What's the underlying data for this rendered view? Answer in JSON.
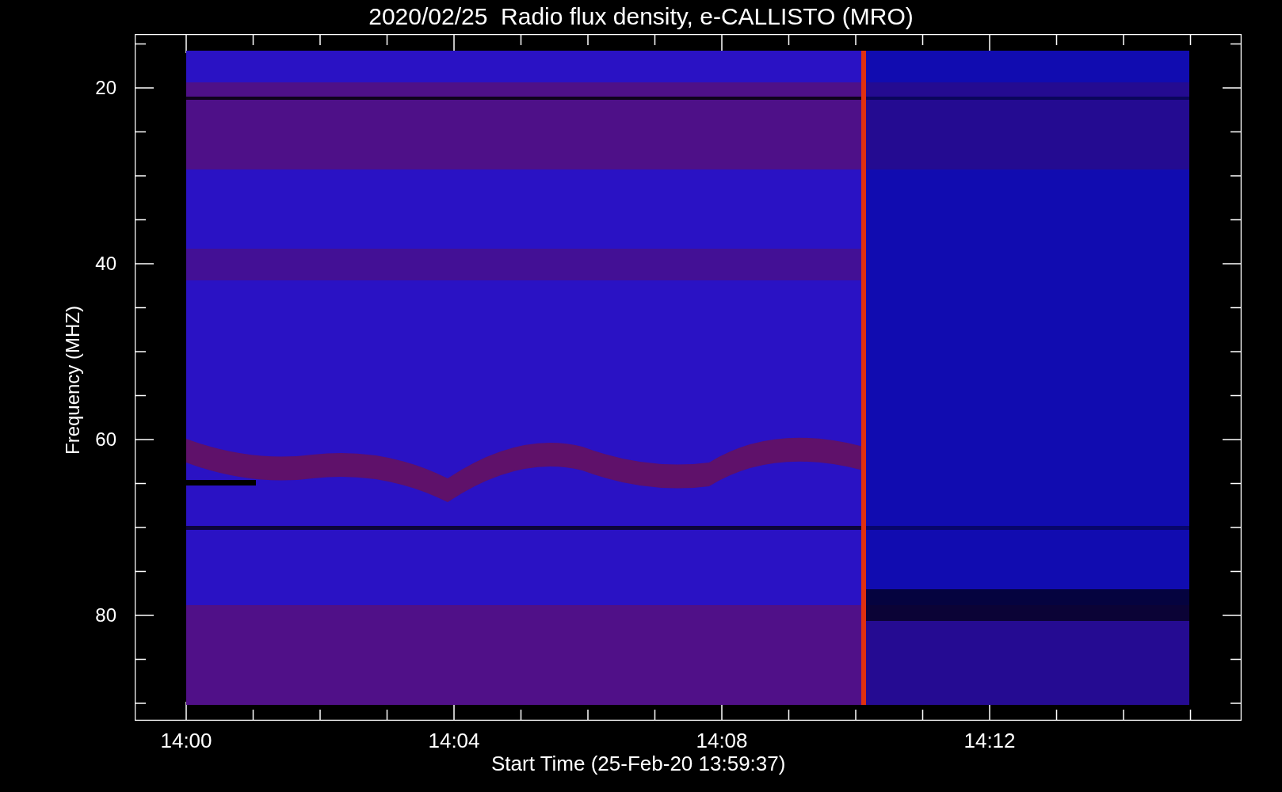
{
  "title": "2020/02/25  Radio flux density, e-CALLISTO (MRO)",
  "y_axis": {
    "label": "Frequency (MHZ)",
    "tick_labels": [
      "20",
      "40",
      "60",
      "80"
    ]
  },
  "x_axis": {
    "label": "Start Time (25-Feb-20 13:59:37)",
    "tick_labels": [
      "14:00",
      "14:04",
      "14:08",
      "14:12"
    ]
  }
}
